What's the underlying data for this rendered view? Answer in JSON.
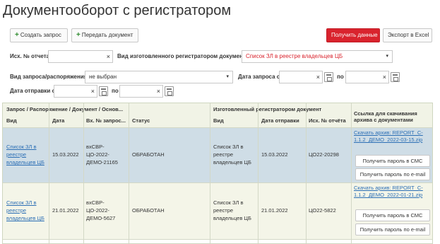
{
  "page": {
    "title": "Документооборот с регистратором"
  },
  "toolbar": {
    "create_label": "Создать запрос",
    "send_label": "Передать документ",
    "get_data_label": "Получить данные",
    "export_label": "Экспорт в Excel",
    "plus_glyph": "+"
  },
  "filters": {
    "ref_label": "Исх. № отчета",
    "ref_value": "",
    "doc_type_label": "Вид изготовленного регистратором документа",
    "doc_type_value": "Список ЗЛ в реестре владельцев ЦБ",
    "request_type_label": "Вид запроса/распоряжения",
    "request_type_value": "не выбран",
    "request_date_label": "Дата запроса с",
    "po_label": "по",
    "send_date_label": "Дата отправки с",
    "clear_glyph": "×",
    "caret_glyph": "▾"
  },
  "table": {
    "group1": "Запрос / Распоряжение / Документ / Основ...",
    "group2": "Изготовленный регистратором документ",
    "group3": "Ссылка для скачивания архива с документами",
    "columns": [
      "Вид",
      "Дата",
      "Вх. № запрос...",
      "Статус",
      "Вид",
      "Дата отправки",
      "Исх. № отчёта"
    ],
    "rows": [
      {
        "type": "Список ЗЛ в реестре владельцев ЦБ",
        "date": "15.03.2022",
        "in_no": "вхСВР-ЦО-2022-ДЕМО-21165",
        "status": "ОБРАБОТАН",
        "doc_type": "Список ЗЛ в реестре владельцев ЦБ",
        "send_date": "15.03.2022",
        "out_no": "ЦО22-20298",
        "archive": "Скачать архив: REPORT_C-1.1.2_ДЕМО_2022-03-15.zip",
        "sms_btn": "Получить пароль в СМС",
        "email_btn": "Получить пароль по e-mail"
      },
      {
        "type": "Список ЗЛ в реестре владельцев ЦБ",
        "date": "21.01.2022",
        "in_no": "вхСВР-ЦО-2022-ДЕМО-5627",
        "status": "ОБРАБОТАН",
        "doc_type": "Список ЗЛ в реестре владельцев ЦБ",
        "send_date": "21.01.2022",
        "out_no": "ЦО22-5822",
        "archive": "Скачать архив: REPORT_C-1.1.2_ДЕМО_2022-01-21.zip",
        "sms_btn": "Получить пароль в СМС",
        "email_btn": "Получить пароль по e-mail"
      }
    ]
  },
  "colors": {
    "accent_red": "#d9232d",
    "row_selected": "#cfdde6",
    "row_alt": "#f4f5e8",
    "link": "#2c6fb5"
  }
}
